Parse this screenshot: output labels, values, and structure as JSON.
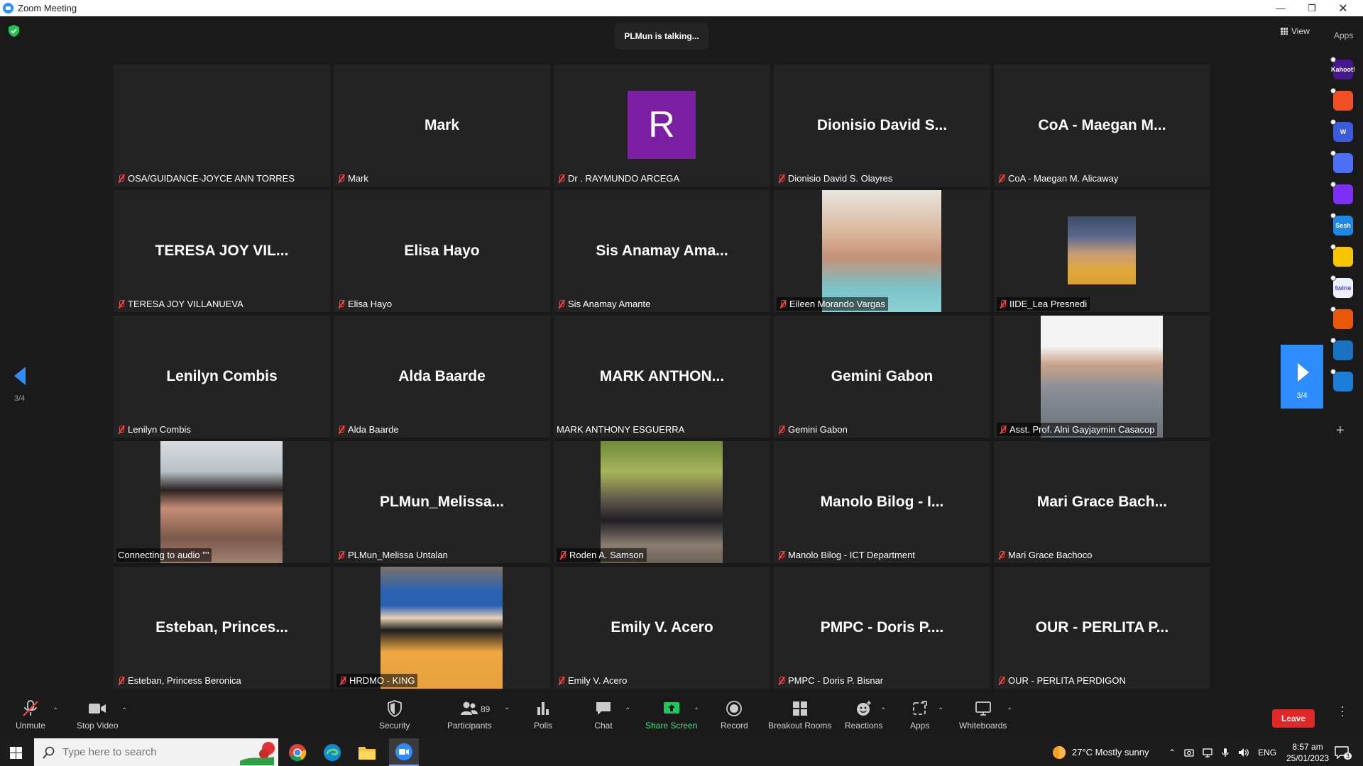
{
  "window": {
    "title": "Zoom Meeting"
  },
  "meeting": {
    "talking_indicator": "PLMun is talking...",
    "view_label": "View",
    "apps_label": "Apps",
    "page_indicator": "3/4"
  },
  "tiles": [
    {
      "big": "",
      "label": "OSA/GUIDANCE-JOYCE ANN TORRES",
      "muted": true
    },
    {
      "big": "Mark",
      "label": "Mark",
      "muted": true
    },
    {
      "big": "",
      "avatar_letter": "R",
      "label": "Dr . RAYMUNDO ARCEGA",
      "muted": true
    },
    {
      "big": "Dionisio David S...",
      "label": "Dionisio David S. Olayres",
      "muted": true
    },
    {
      "big": "CoA - Maegan M...",
      "label": "CoA - Maegan M. Alicaway",
      "muted": true
    },
    {
      "big": "TERESA JOY VIL...",
      "label": "TERESA JOY VILLANUEVA",
      "muted": true
    },
    {
      "big": "Elisa Hayo",
      "label": "Elisa Hayo",
      "muted": true
    },
    {
      "big": "Sis Anamay Ama...",
      "label": "Sis Anamay Amante",
      "muted": true
    },
    {
      "big": "",
      "photo": true,
      "label": "Eileen Morando Vargas",
      "muted": true
    },
    {
      "big": "",
      "photo": true,
      "label": "IIDE_Lea Presnedi",
      "muted": true
    },
    {
      "big": "Lenilyn Combis",
      "label": "Lenilyn Combis",
      "muted": true
    },
    {
      "big": "Alda Baarde",
      "label": "Alda Baarde",
      "muted": true
    },
    {
      "big": "MARK  ANTHON...",
      "label": "MARK ANTHONY ESGUERRA",
      "muted": false
    },
    {
      "big": "Gemini Gabon",
      "label": "Gemini Gabon",
      "muted": true
    },
    {
      "big": "",
      "photo": true,
      "label": "Asst. Prof. Alni Gayjaymin Casacop",
      "muted": true
    },
    {
      "big": "",
      "photo": true,
      "label": "Connecting to audio \"\"",
      "muted": false
    },
    {
      "big": "PLMun_Melissa...",
      "label": "PLMun_Melissa Untalan",
      "muted": true
    },
    {
      "big": "",
      "photo": true,
      "label": "Roden A. Samson",
      "muted": true
    },
    {
      "big": "Manolo Bilog - I...",
      "label": "Manolo Bilog - ICT Department",
      "muted": true
    },
    {
      "big": "Mari Grace Bach...",
      "label": "Mari Grace Bachoco",
      "muted": true
    },
    {
      "big": "Esteban, Princes...",
      "label": "Esteban, Princess Beronica",
      "muted": true
    },
    {
      "big": "",
      "photo": true,
      "label": "HRDMO - KING",
      "muted": true
    },
    {
      "big": "Emily V. Acero",
      "label": "Emily V. Acero",
      "muted": true
    },
    {
      "big": "PMPC - Doris P....",
      "label": "PMPC - Doris P. Bisnar",
      "muted": true
    },
    {
      "big": "OUR - PERLITA P...",
      "label": "OUR - PERLITA PERDIGON",
      "muted": true
    }
  ],
  "rail_apps": [
    {
      "name": "kahoot-icon",
      "text": "Kahoot!",
      "color": "#46178f"
    },
    {
      "name": "scribble-icon",
      "text": "",
      "color": "#f04e23"
    },
    {
      "name": "wordwall-icon",
      "text": "W",
      "color": "#3b5bdb"
    },
    {
      "name": "chat-bubble-icon",
      "text": "",
      "color": "#4c6ef5"
    },
    {
      "name": "stripes-app-icon",
      "text": "",
      "color": "#7b2ff7"
    },
    {
      "name": "sesh-icon",
      "text": "Sesh",
      "color": "#1e88e5"
    },
    {
      "name": "emoji-app-icon",
      "text": "",
      "color": "#f7c600"
    },
    {
      "name": "twine-icon",
      "text": "twine",
      "color": "#eef1ff"
    },
    {
      "name": "mosaic-app-icon",
      "text": "",
      "color": "#e8590c"
    },
    {
      "name": "sync-app-icon",
      "text": "",
      "color": "#1971c2"
    },
    {
      "name": "stack-app-icon",
      "text": "",
      "color": "#1c7ed6"
    }
  ],
  "toolbar": {
    "unmute": "Unmute",
    "stop_video": "Stop Video",
    "security": "Security",
    "participants": "Participants",
    "participants_count": "89",
    "polls": "Polls",
    "chat": "Chat",
    "share_screen": "Share Screen",
    "record": "Record",
    "breakout_rooms": "Breakout Rooms",
    "reactions": "Reactions",
    "apps": "Apps",
    "whiteboards": "Whiteboards",
    "leave": "Leave"
  },
  "taskbar": {
    "search_placeholder": "Type here to search",
    "weather": "27°C  Mostly sunny",
    "lang": "ENG",
    "time": "8:57 am",
    "date": "25/01/2023",
    "notifications": "3"
  },
  "colors": {
    "accent": "#2d8cff",
    "leave": "#e02828",
    "share": "#22c55e",
    "muted_icon": "#e94e4e"
  }
}
